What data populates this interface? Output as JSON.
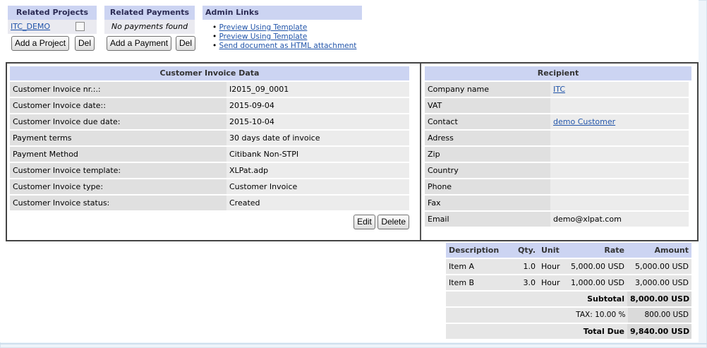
{
  "related_projects": {
    "header": "Related Projects",
    "project": "ITC_DEMO",
    "add_label": "Add a Project",
    "del_label": "Del"
  },
  "related_payments": {
    "header": "Related Payments",
    "empty": "No payments found",
    "add_label": "Add a Payment",
    "del_label": "Del"
  },
  "admin_links": {
    "header": "Admin Links",
    "links": [
      "Preview Using Template",
      "Preview Using Template",
      "Send document as HTML attachment"
    ]
  },
  "invoice": {
    "header": "Customer Invoice Data",
    "rows": [
      {
        "label": "Customer Invoice nr.:.:",
        "value": "I2015_09_0001"
      },
      {
        "label": "Customer Invoice date::",
        "value": "2015-09-04"
      },
      {
        "label": "Customer Invoice due date:",
        "value": "2015-10-04"
      },
      {
        "label": "Payment terms",
        "value": "30 days date of invoice"
      },
      {
        "label": "Payment Method",
        "value": "Citibank Non-STPI"
      },
      {
        "label": "Customer Invoice template:",
        "value": "XLPat.adp"
      },
      {
        "label": "Customer Invoice type:",
        "value": "Customer Invoice"
      },
      {
        "label": "Customer Invoice status:",
        "value": "Created"
      }
    ],
    "edit_label": "Edit",
    "delete_label": "Delete"
  },
  "recipient": {
    "header": "Recipient",
    "rows": [
      {
        "label": "Company name",
        "value": "ITC"
      },
      {
        "label": "VAT",
        "value": ""
      },
      {
        "label": "Contact",
        "value": "demo Customer"
      },
      {
        "label": "Adress",
        "value": ""
      },
      {
        "label": "Zip",
        "value": ""
      },
      {
        "label": "Country",
        "value": ""
      },
      {
        "label": "Phone",
        "value": ""
      },
      {
        "label": "Fax",
        "value": ""
      },
      {
        "label": "Email",
        "value": "demo@xlpat.com"
      }
    ]
  },
  "items": {
    "headers": {
      "description": "Description",
      "qty": "Qty.",
      "unit": "Unit",
      "rate": "Rate",
      "amount": "Amount"
    },
    "rows": [
      {
        "description": "Item A",
        "qty": "1.0",
        "unit": "Hour",
        "rate": "5,000.00 USD",
        "amount": "5,000.00 USD"
      },
      {
        "description": "Item B",
        "qty": "3.0",
        "unit": "Hour",
        "rate": "1,000.00 USD",
        "amount": "3,000.00 USD"
      }
    ],
    "subtotal_label": "Subtotal",
    "subtotal_value": "8,000.00 USD",
    "tax_label": "TAX: 10.00 %",
    "tax_value": "800.00 USD",
    "total_label": "Total Due",
    "total_value": "9,840.00 USD"
  }
}
